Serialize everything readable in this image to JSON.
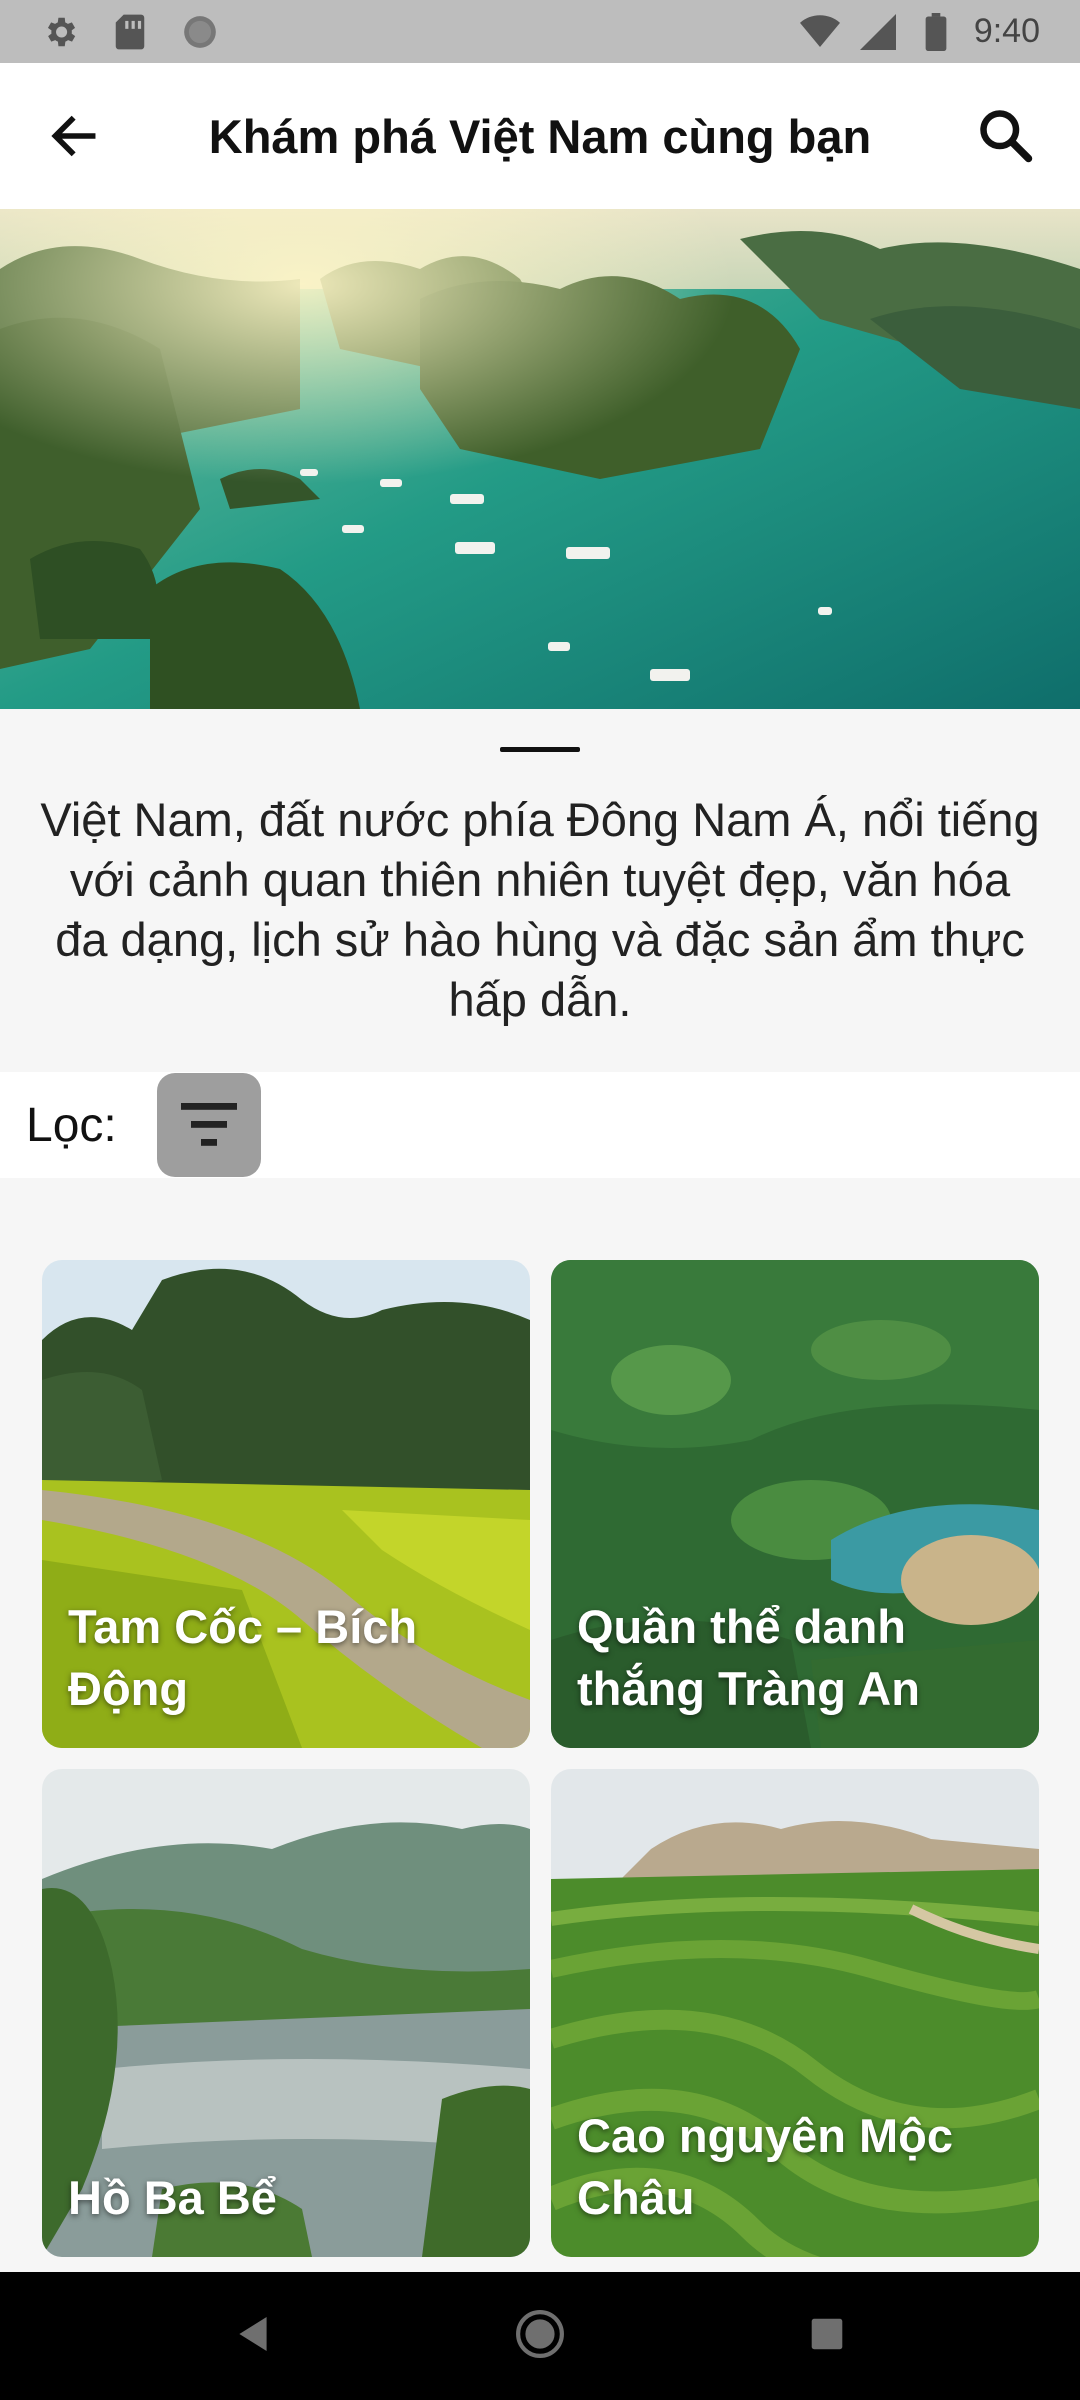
{
  "status_bar": {
    "time": "9:40",
    "left_icons": [
      "settings-icon",
      "sim-card-icon",
      "circle-status-icon"
    ],
    "right_icons": [
      "wifi-icon",
      "signal-icon",
      "battery-icon"
    ]
  },
  "app_bar": {
    "title": "Khám phá Việt Nam cùng bạn",
    "back_icon": "arrow-left-icon",
    "search_icon": "search-icon"
  },
  "description": "Việt Nam, đất nước phía Đông Nam Á, nổi tiếng với cảnh quan thiên nhiên tuyệt đẹp, văn hóa đa dạng, lịch sử hào hùng và đặc sản ẩm thực hấp dẫn.",
  "filter": {
    "label": "Lọc:",
    "icon": "filter-icon"
  },
  "places": [
    {
      "title": "Tam Cốc – Bích Động"
    },
    {
      "title": "Quần thể danh thắng Tràng An"
    },
    {
      "title": "Hồ Ba Bể"
    },
    {
      "title": "Cao nguyên Mộc Châu"
    }
  ],
  "nav_bar": {
    "icons": [
      "back-triangle-icon",
      "home-circle-icon",
      "recents-square-icon"
    ]
  },
  "colors": {
    "status_bar": "#bdbdbd",
    "app_bar": "#ffffff",
    "page_bg": "#f6f6f6",
    "filter_button": "#9e9e9e",
    "nav_bar": "#000000"
  }
}
